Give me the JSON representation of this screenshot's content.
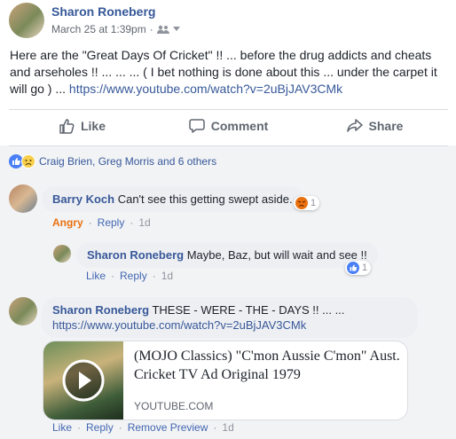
{
  "post": {
    "author": "Sharon Roneberg",
    "timestamp": "March 25 at 1:39pm",
    "audience_icon": "friends-icon",
    "text": "Here are the \"Great Days Of Cricket\" !! ... before the drug addicts and cheats and arseholes !! ... ... ... ( I bet nothing is done about this ... under the carpet it will go ) ... ",
    "link": "https://www.youtube.com/watch?v=2uBjJAV3CMk"
  },
  "actions": {
    "like": "Like",
    "comment": "Comment",
    "share": "Share"
  },
  "reactions_summary": {
    "text": "Craig Brien, Greg Morris and 6 others",
    "icons": [
      "like-reaction-icon",
      "sad-reaction-icon"
    ]
  },
  "comments": [
    {
      "author": "Barry Koch",
      "text": "Can't see this getting swept aside.",
      "reaction_label": "Angry",
      "reply": "Reply",
      "age": "1d",
      "reaction_count": "1"
    },
    {
      "author": "Sharon Roneberg",
      "text": "Maybe, Baz, but will wait and see !!",
      "like": "Like",
      "reply": "Reply",
      "age": "1d",
      "reaction_count": "1"
    },
    {
      "author": "Sharon Roneberg",
      "text": "THESE - WERE - THE - DAYS !! ... ...",
      "link": "https://www.youtube.com/watch?v=2uBjJAV3CMk",
      "like": "Like",
      "reply": "Reply",
      "remove_preview": "Remove Preview",
      "age": "1d"
    }
  ],
  "link_card": {
    "title": "(MOJO Classics) \"C'mon Aussie C'mon\" Aust. Cricket TV Ad Original 1979",
    "source": "YOUTUBE.COM"
  },
  "colors": {
    "name_blue": "#365899",
    "link_blue": "#4267b2",
    "angry_orange": "#e9710f",
    "bubble": "#edeff3"
  }
}
